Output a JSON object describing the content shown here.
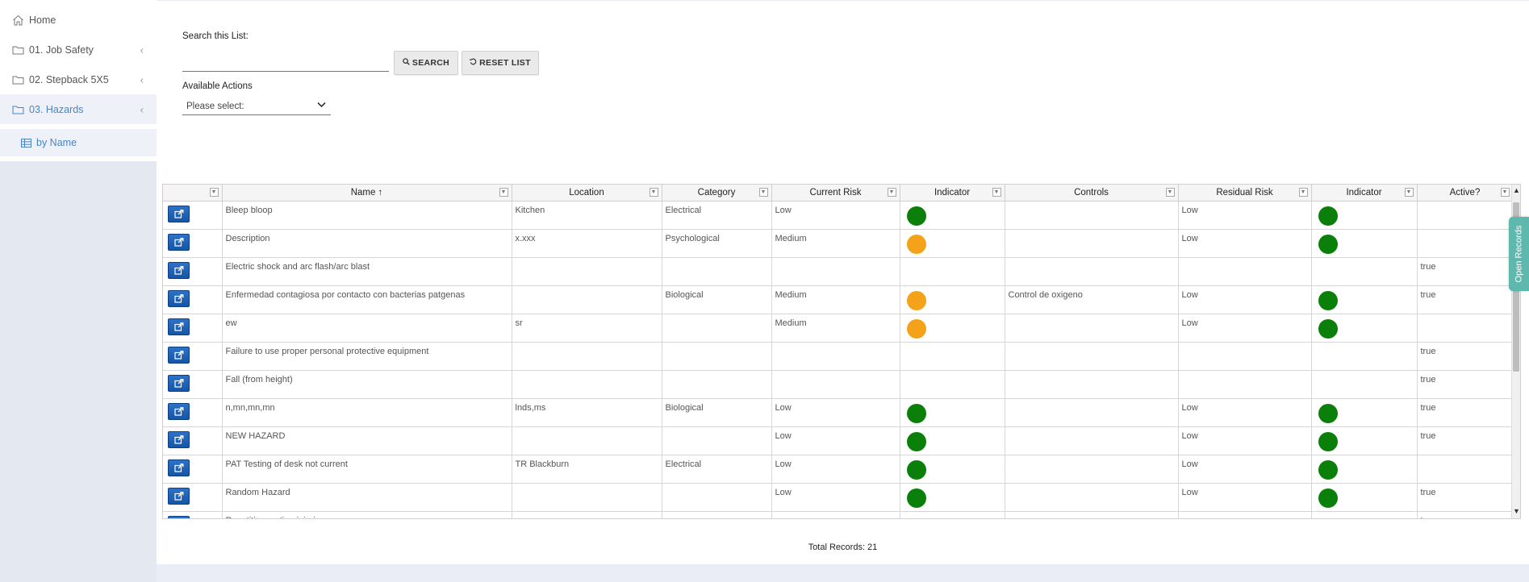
{
  "sidebar": {
    "items": [
      {
        "label": "Home",
        "icon": "home-icon"
      },
      {
        "label": "01. Job Safety",
        "icon": "folder-icon"
      },
      {
        "label": "02. Stepback 5X5",
        "icon": "folder-icon"
      },
      {
        "label": "03. Hazards",
        "icon": "folder-icon"
      }
    ],
    "subitem": {
      "label": "by Name",
      "icon": "table-icon"
    }
  },
  "search": {
    "label": "Search this List:",
    "value": "",
    "search_button": "SEARCH",
    "reset_button": "RESET LIST"
  },
  "actions": {
    "label": "Available Actions",
    "selected": "Please select:"
  },
  "grid": {
    "columns": [
      "",
      "Name ↑",
      "Location",
      "Category",
      "Current Risk",
      "Indicator",
      "Controls",
      "Residual Risk",
      "Indicator",
      "Active?"
    ],
    "rows": [
      {
        "name": "Bleep bloop",
        "location": "Kitchen",
        "category": "Electrical",
        "current_risk": "Low",
        "ind1": "green",
        "controls": "",
        "residual_risk": "Low",
        "ind2": "green",
        "active": ""
      },
      {
        "name": "Description",
        "location": "x.xxx",
        "category": "Psychological",
        "current_risk": "Medium",
        "ind1": "orange",
        "controls": "",
        "residual_risk": "Low",
        "ind2": "green",
        "active": ""
      },
      {
        "name": "Electric shock and arc flash/arc blast",
        "location": "",
        "category": "",
        "current_risk": "",
        "ind1": "",
        "controls": "",
        "residual_risk": "",
        "ind2": "",
        "active": "true"
      },
      {
        "name": "Enfermedad contagiosa por contacto con bacterias patgenas",
        "location": "",
        "category": "Biological",
        "current_risk": "Medium",
        "ind1": "orange",
        "controls": "Control de oxigeno",
        "residual_risk": "Low",
        "ind2": "green",
        "active": "true"
      },
      {
        "name": "ew",
        "location": "sr",
        "category": "",
        "current_risk": "Medium",
        "ind1": "orange",
        "controls": "",
        "residual_risk": "Low",
        "ind2": "green",
        "active": ""
      },
      {
        "name": "Failure to use proper personal protective equipment",
        "location": "",
        "category": "",
        "current_risk": "",
        "ind1": "",
        "controls": "",
        "residual_risk": "",
        "ind2": "",
        "active": "true"
      },
      {
        "name": "Fall (from height)",
        "location": "",
        "category": "",
        "current_risk": "",
        "ind1": "",
        "controls": "",
        "residual_risk": "",
        "ind2": "",
        "active": "true"
      },
      {
        "name": "n,mn,mn,mn",
        "location": "lnds,ms",
        "category": "Biological",
        "current_risk": "Low",
        "ind1": "green",
        "controls": "",
        "residual_risk": "Low",
        "ind2": "green",
        "active": "true"
      },
      {
        "name": "NEW HAZARD",
        "location": "",
        "category": "",
        "current_risk": "Low",
        "ind1": "green",
        "controls": "",
        "residual_risk": "Low",
        "ind2": "green",
        "active": "true"
      },
      {
        "name": "PAT Testing of desk not current",
        "location": "TR Blackburn",
        "category": "Electrical",
        "current_risk": "Low",
        "ind1": "green",
        "controls": "",
        "residual_risk": "Low",
        "ind2": "green",
        "active": ""
      },
      {
        "name": "Random Hazard",
        "location": "",
        "category": "",
        "current_risk": "Low",
        "ind1": "green",
        "controls": "",
        "residual_risk": "Low",
        "ind2": "green",
        "active": "true"
      },
      {
        "name": "Repetitive motion injuries",
        "location": "",
        "category": "",
        "current_risk": "",
        "ind1": "",
        "controls": "",
        "residual_risk": "",
        "ind2": "",
        "active": "true"
      }
    ]
  },
  "colors": {
    "green": "#0a7f0a",
    "orange": "#f5a21b",
    "accent": "#4a84c4",
    "tab": "#5fb8ae"
  },
  "footer": {
    "total_label": "Total Records: 21"
  },
  "side_tab": {
    "label": "Open Records"
  }
}
